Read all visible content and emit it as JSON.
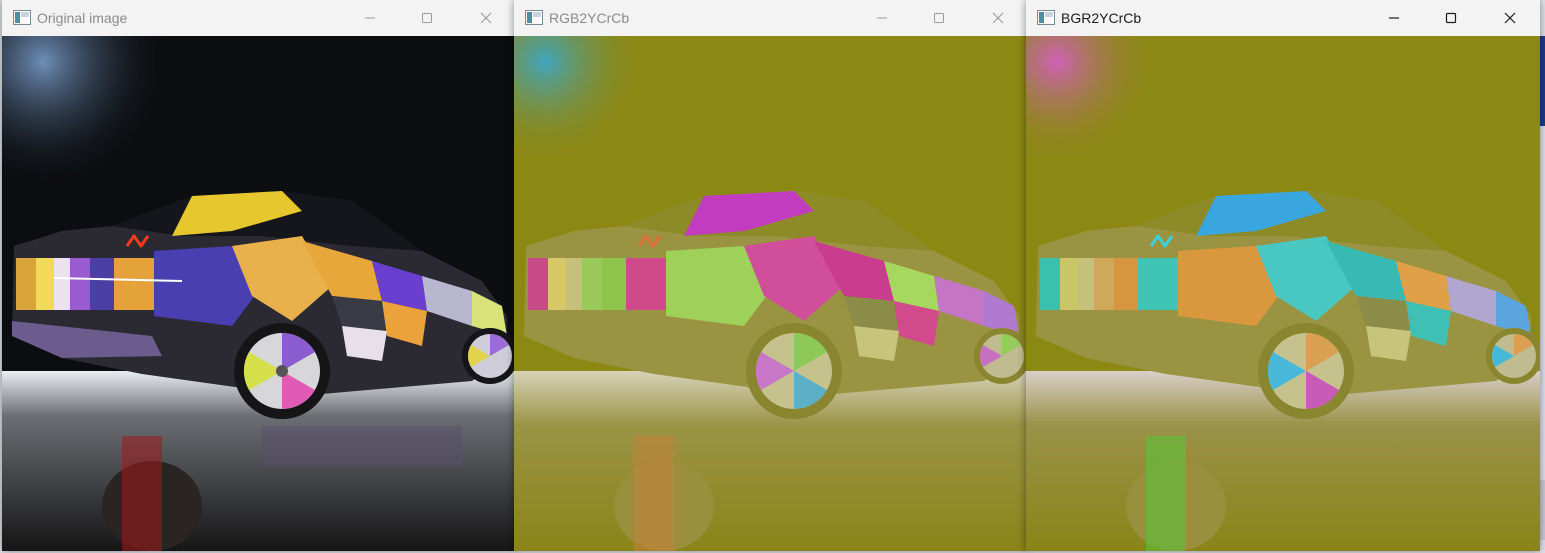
{
  "windows": [
    {
      "title": "Original image",
      "active": false
    },
    {
      "title": "RGB2YCrCb",
      "active": false
    },
    {
      "title": "BGR2YCrCb",
      "active": true
    }
  ],
  "icons": {
    "app": "opencv-window-icon",
    "minimize": "minimize-icon",
    "maximize": "maximize-icon",
    "close": "close-icon"
  },
  "colors": {
    "titlebar": "#f3f3f3",
    "inactive_title_text": "#8b8b8b",
    "active_title_text": "#1b1b1b",
    "ycrcb_background": "#8c8814",
    "original_background": "#0b0d10"
  }
}
